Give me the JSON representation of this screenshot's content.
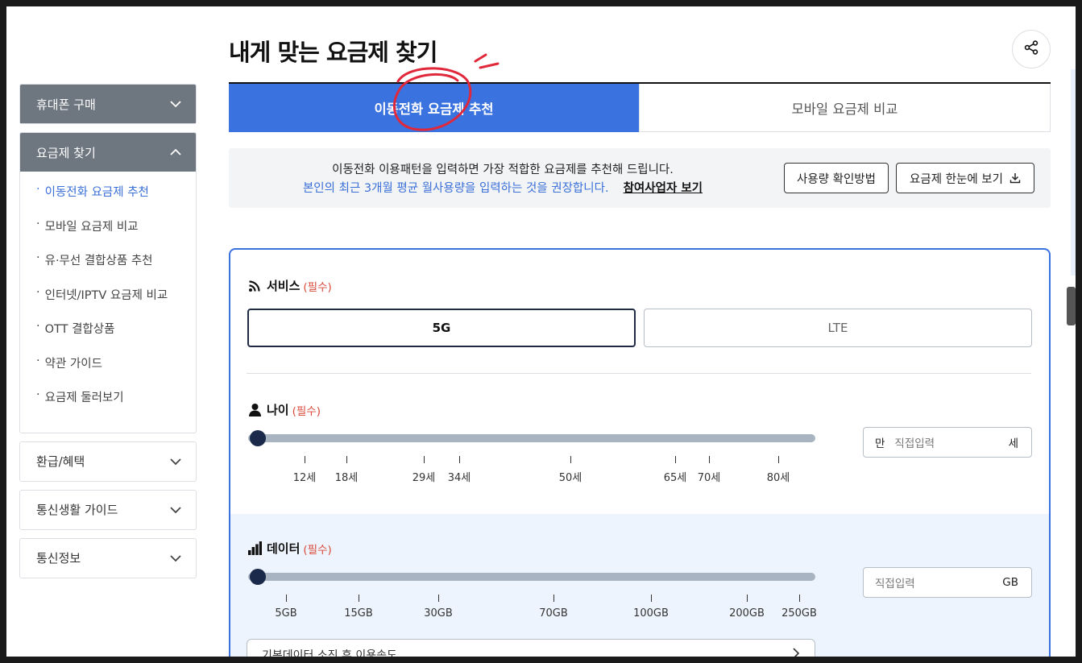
{
  "page": {
    "title": "내게 맞는 요금제 찾기"
  },
  "sidebar": {
    "sections": [
      {
        "label": "휴대폰 구매",
        "expanded": false
      },
      {
        "label": "요금제 찾기",
        "expanded": true
      },
      {
        "label": "환급/혜택",
        "expanded": false
      },
      {
        "label": "통신생활 가이드",
        "expanded": false
      },
      {
        "label": "통신정보",
        "expanded": false
      }
    ],
    "sub_items": [
      {
        "label": "이동전화 요금제 추천",
        "active": true
      },
      {
        "label": "모바일 요금제 비교",
        "active": false
      },
      {
        "label": "유·무선 결합상품 추천",
        "active": false
      },
      {
        "label": "인터넷/IPTV 요금제 비교",
        "active": false
      },
      {
        "label": "OTT 결합상품",
        "active": false
      },
      {
        "label": "약관 가이드",
        "active": false
      },
      {
        "label": "요금제 둘러보기",
        "active": false
      }
    ],
    "bullet": "·"
  },
  "tabs": [
    {
      "label": "이동전화 요금제 추천",
      "active": true
    },
    {
      "label": "모바일 요금제 비교",
      "active": false
    }
  ],
  "notice": {
    "line1": "이동전화 이용패턴을 입력하면 가장 적합한 요금제를 추천해 드립니다.",
    "line2": "본인의 최근 3개월 평균 월사용량을 입력하는 것을 권장합니다.",
    "link": "참여사업자 보기",
    "btn_usage": "사용량 확인방법",
    "btn_view_all": "요금제 한눈에 보기"
  },
  "form": {
    "required": "(필수)",
    "service": {
      "label": "서비스",
      "options": [
        "5G",
        "LTE"
      ],
      "selected": "5G"
    },
    "age": {
      "label": "나이",
      "ticks": [
        "12세",
        "18세",
        "29세",
        "34세",
        "50세",
        "65세",
        "70세",
        "80세"
      ],
      "slider_fraction": 0,
      "input_prefix": "만",
      "input_placeholder": "직접입력",
      "input_unit": "세"
    },
    "data": {
      "label": "데이터",
      "ticks": [
        "5GB",
        "15GB",
        "30GB",
        "70GB",
        "100GB",
        "200GB",
        "250GB"
      ],
      "slider_fraction": 0,
      "input_placeholder": "직접입력",
      "input_unit": "GB",
      "more_row": "기본데이터 소진 후 이용속도"
    }
  },
  "colors": {
    "accent": "#3a72df",
    "required": "#d94a3a",
    "slider_track": "#a8b4c2",
    "slider_thumb": "#1b2a4a"
  }
}
